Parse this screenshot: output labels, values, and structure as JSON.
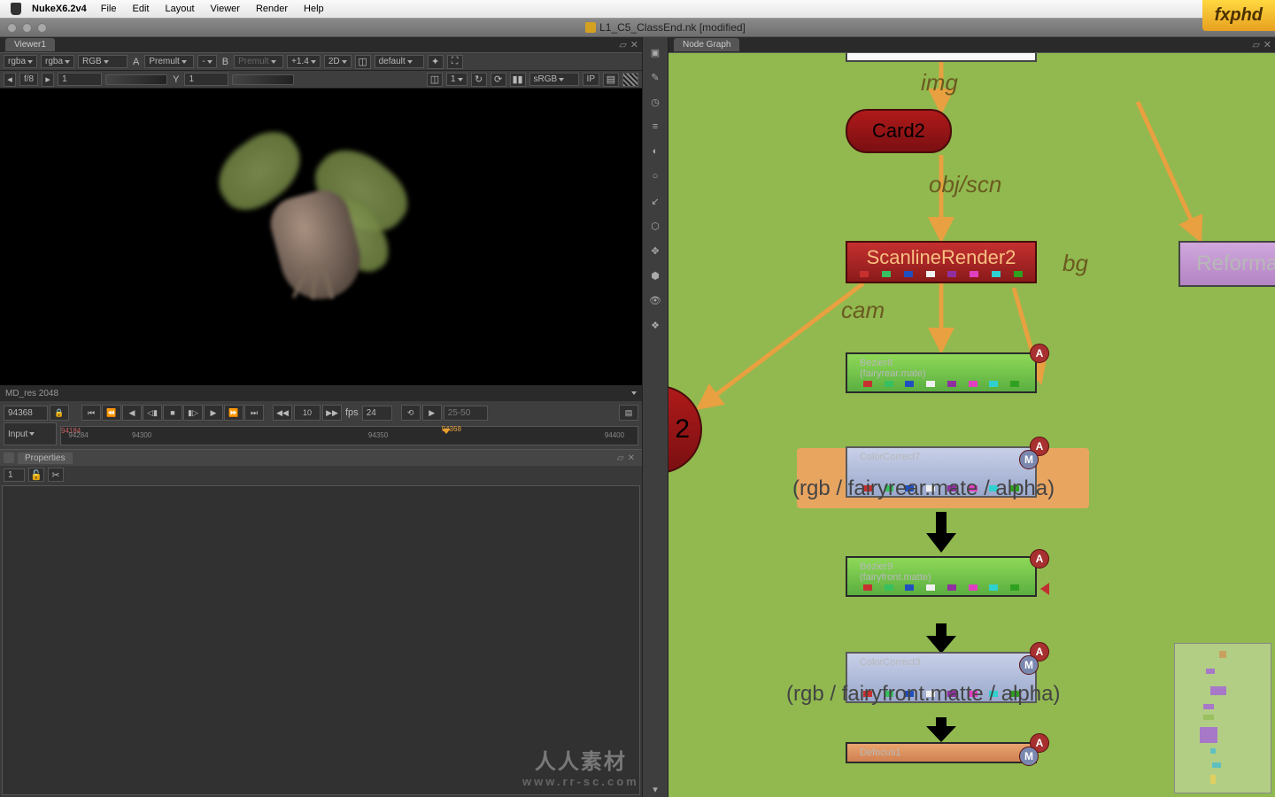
{
  "menubar": {
    "app": "NukeX6.2v4",
    "items": [
      "File",
      "Edit",
      "Layout",
      "Viewer",
      "Render",
      "Help"
    ]
  },
  "titlebar": {
    "document": "L1_C5_ClassEnd.nk [modified]"
  },
  "viewer": {
    "tab": "Viewer1",
    "channels1": "rgba",
    "channels2": "rgba",
    "layer": "RGB",
    "input_a": "A",
    "premult_a": "Premult",
    "blend": "-",
    "input_b": "B",
    "premult_b": "Premult",
    "gain": "+1.4",
    "dim": "2D",
    "lut_preset": "default",
    "fstop_btn": "f/8",
    "fstop_val": "1",
    "y_val": "1",
    "y_label": "Y",
    "clip": "1",
    "colorspace": "sRGB",
    "ip": "IP",
    "status": "MD_res 2048"
  },
  "timeline": {
    "current_frame": "94368",
    "input_label": "Input",
    "step": "10",
    "fps_label": "fps",
    "fps": "24",
    "range_placeholder": "25-50",
    "ticks": [
      "94284",
      "94300",
      "94350",
      "94400"
    ],
    "marker_red_a": "94184",
    "marker_red_b": "94368"
  },
  "properties": {
    "title": "Properties",
    "count": "1"
  },
  "nodegraph": {
    "tab": "Node Graph",
    "labels": {
      "img": "img",
      "objscn": "obj/scn",
      "cam": "cam",
      "bg": "bg"
    },
    "nodes": {
      "card2": "Card2",
      "scanline": "ScanlineRender2",
      "reformat": "Reformat",
      "bezier8_title": "Bezier8",
      "bezier8_sub": "(fairyrear.mate)",
      "cc7_title": "ColorCorrect7",
      "cc7_wide": "(rgb / fairyrear.mate / alpha)",
      "bezier9_title": "Bezier9",
      "bezier9_sub": "(fairyfront.matte)",
      "cc3_title": "ColorCorrect3",
      "cc3_wide": "(rgb / fairyfront.matte / alpha)",
      "defocus": "Defocus1",
      "side_num": "2"
    },
    "badge_a": "A",
    "badge_m": "M"
  },
  "branding": {
    "fxphd": "fxphd",
    "watermark": "人人素材",
    "watermark_url": "www.rr-sc.com"
  },
  "colors": {
    "strip": [
      "#c83030",
      "#38c060",
      "#2050c0",
      "#f0f0f0",
      "#9030a0",
      "#e040c0",
      "#30d0d0",
      "#30a020"
    ]
  }
}
